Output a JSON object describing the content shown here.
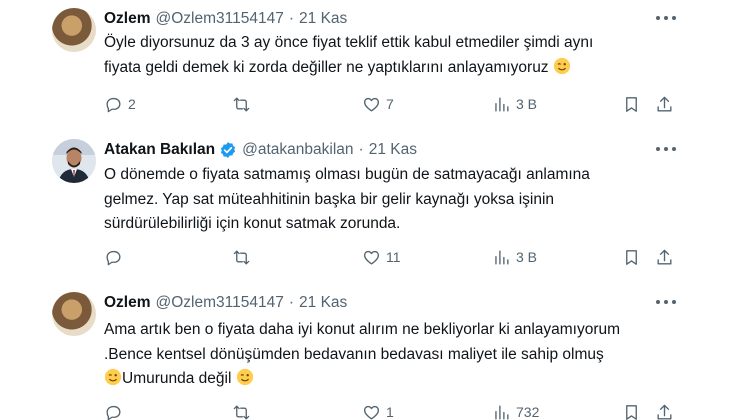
{
  "tweets": [
    {
      "name": "Ozlem",
      "handle": "@Ozlem31154147",
      "dot": "·",
      "date": "21 Kas",
      "verified": false,
      "lines": [
        "Öyle diyorsunuz da 3 ay önce fiyat teklif ettik kabul etmediler şimdi aynı",
        "fiyata geldi demek ki zorda değiller ne yaptıklarını anlayamıyoruz"
      ],
      "replies": "2",
      "retweets": "",
      "likes": "7",
      "views": "3 B"
    },
    {
      "name": "Atakan Bakılan",
      "handle": "@atakanbakilan",
      "dot": "·",
      "date": "21 Kas",
      "verified": true,
      "lines": [
        "O dönemde o fiyata satmamış olması bugün de satmayacağı anlamına",
        "gelmez. Yap sat müteahhitinin başka bir gelir kaynağı yoksa işinin",
        "sürdürülebilirliği için konut satmak zorunda."
      ],
      "replies": "",
      "retweets": "",
      "likes": "11",
      "views": "3 B"
    },
    {
      "name": "Ozlem",
      "handle": "@Ozlem31154147",
      "dot": "·",
      "date": "21 Kas",
      "verified": false,
      "lines": [
        "Ama artık ben o fiyata daha iyi konut alırım ne bekliyorlar ki anlayamıyorum",
        ".Bence kentsel dönüşümden bedavanın bedavası maliyet ile sahip olmuş",
        "Umurunda değil"
      ],
      "replies": "",
      "retweets": "",
      "likes": "1",
      "views": "732"
    }
  ],
  "colors": {
    "text": "#0f1419",
    "muted": "#536471",
    "verified": "#1d9bf0"
  },
  "icons": {
    "reply": "reply-icon",
    "retweet": "retweet-icon",
    "like": "heart-icon",
    "views": "views-icon",
    "bookmark": "bookmark-icon",
    "share": "share-icon",
    "more": "more-icon",
    "emoji": "winking-face-emoji"
  }
}
